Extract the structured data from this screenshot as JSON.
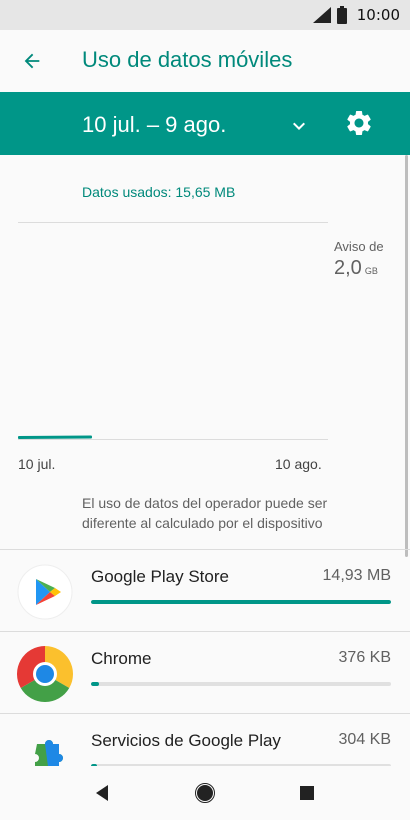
{
  "status_bar": {
    "time": "10:00"
  },
  "header": {
    "title": "Uso de datos móviles"
  },
  "cycle": {
    "label": "10 jul. – 9 ago."
  },
  "summary": {
    "data_used": "Datos usados: 15,65 MB"
  },
  "chart": {
    "warning_label": "Aviso de",
    "warning_value": "2,0",
    "warning_unit": "GB",
    "axis_start": "10 jul.",
    "axis_end": "10 ago."
  },
  "chart_data": {
    "type": "line",
    "x": [
      "10 jul.",
      "10 ago."
    ],
    "warning": {
      "label": "Aviso de",
      "value": 2.0,
      "unit": "GB"
    },
    "series": [
      {
        "usage_fraction_of_period": 0.24
      }
    ]
  },
  "note": {
    "text": "El uso de datos del operador puede ser diferente al calculado por el dispositivo"
  },
  "apps": [
    {
      "name": "Google Play Store",
      "size": "14,93 MB",
      "usage_fraction": 1.0
    },
    {
      "name": "Chrome",
      "size": "376 KB",
      "usage_fraction": 0.025
    },
    {
      "name": "Servicios de Google Play",
      "size": "304 KB",
      "usage_fraction": 0.02
    }
  ],
  "colors": {
    "accent": "#009688",
    "accent_dark": "#00897b",
    "status_bar": "#e6e6e6"
  },
  "icons": {
    "back": "arrow-back-icon",
    "dropdown": "chevron-down-icon",
    "settings": "gear-icon",
    "nav_back": "triangle-back-icon",
    "nav_home": "circle-home-icon",
    "nav_recents": "square-recents-icon"
  }
}
